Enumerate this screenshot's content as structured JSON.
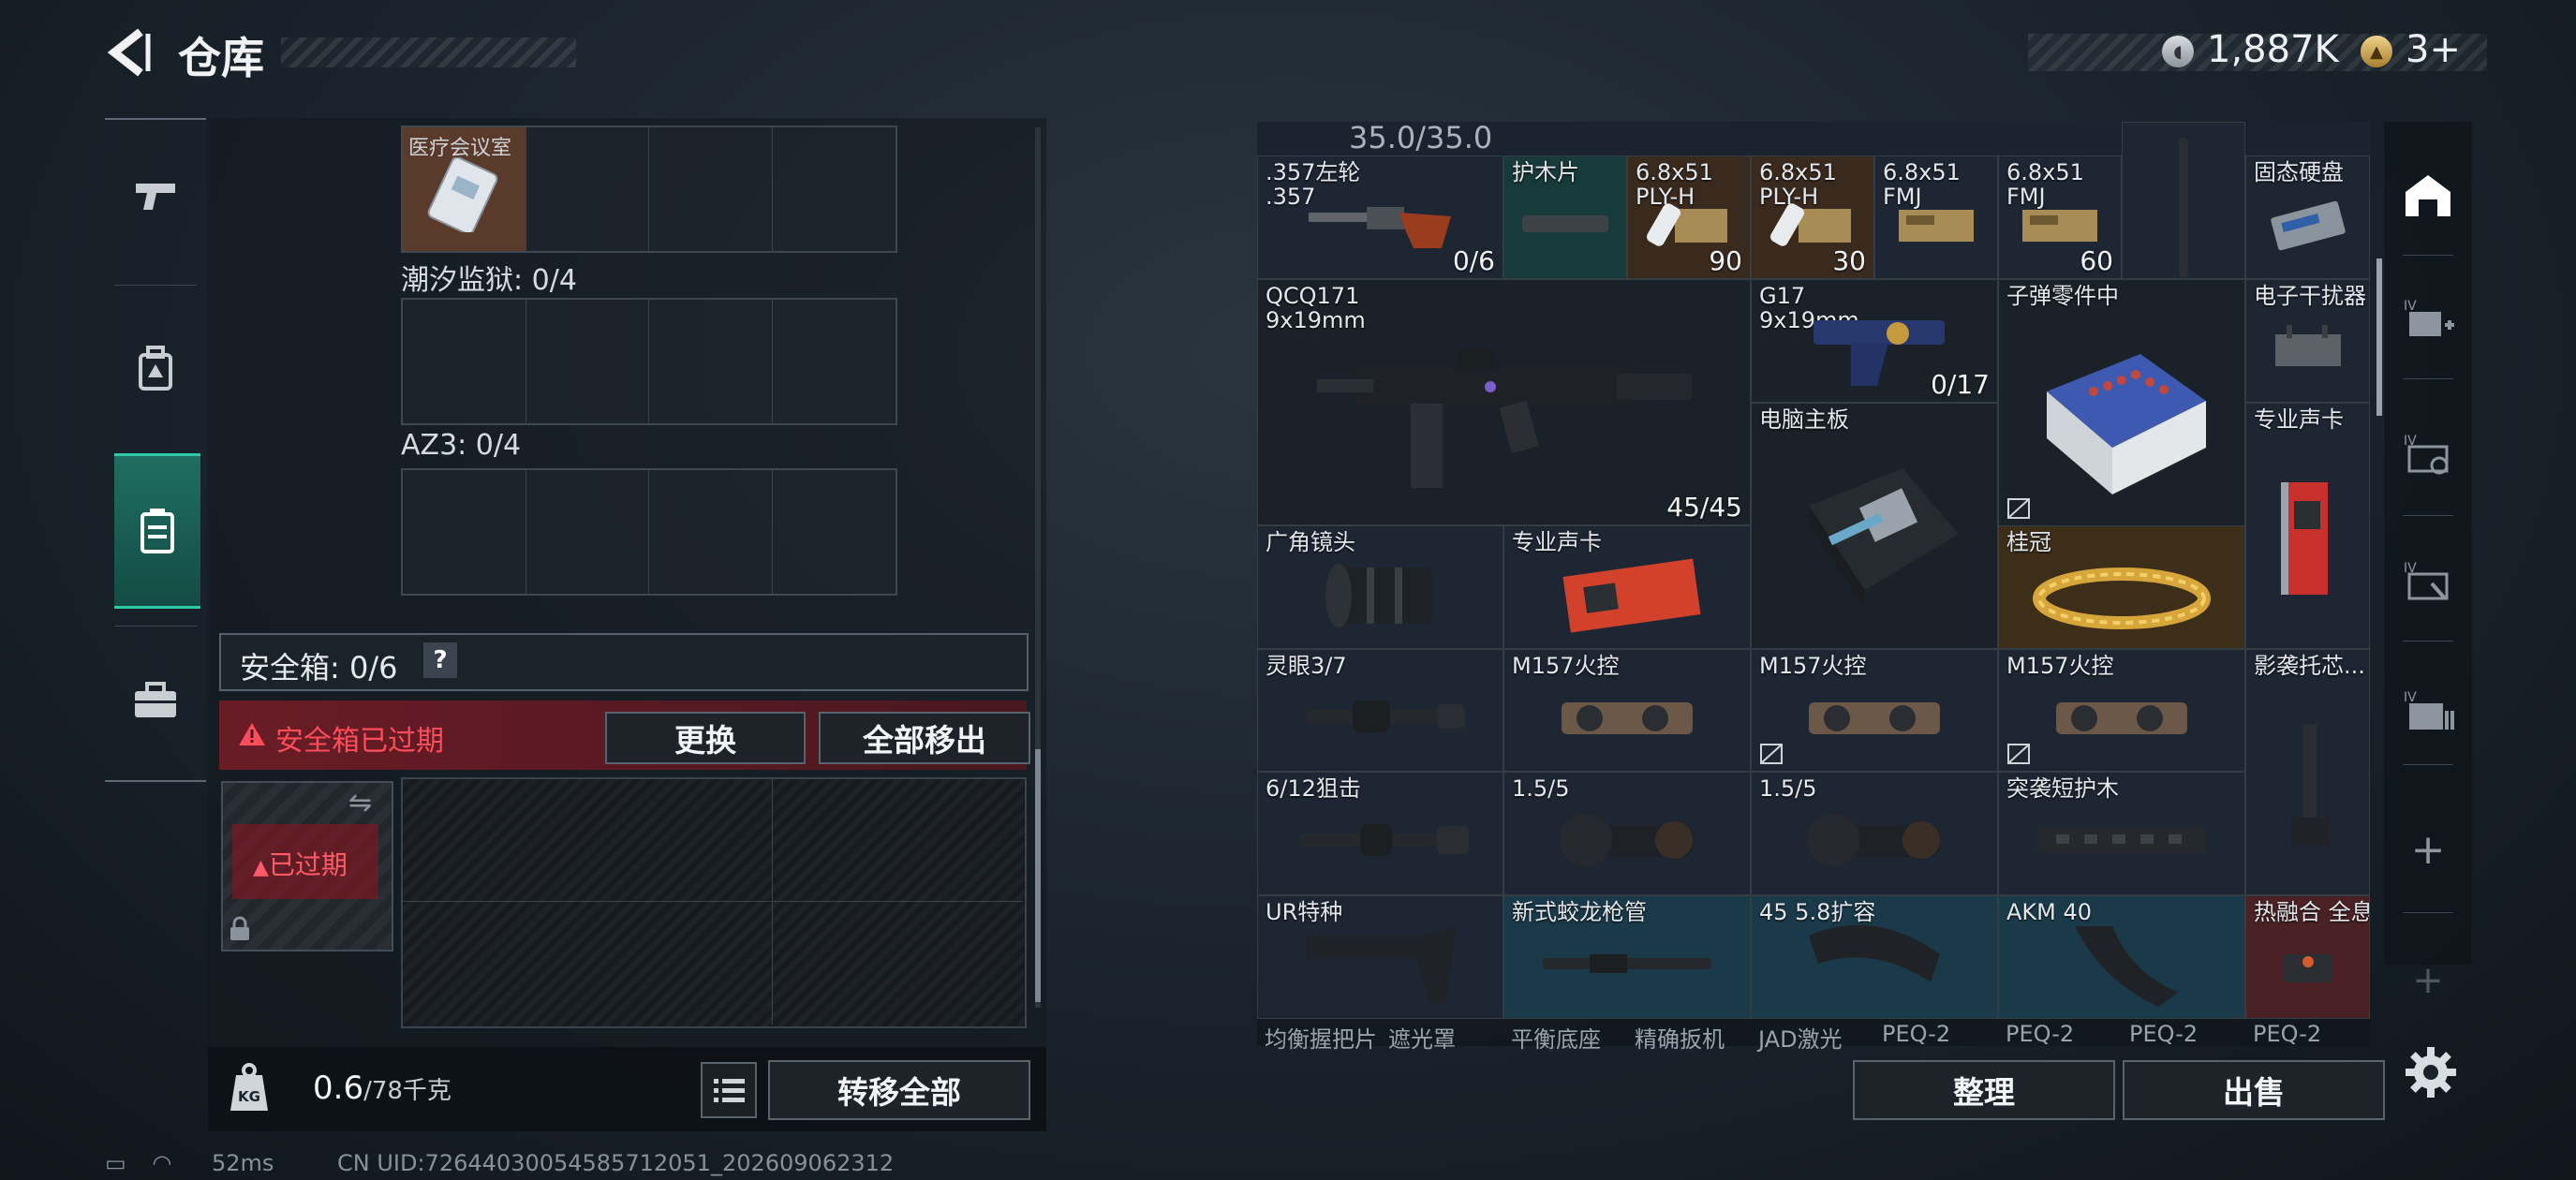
{
  "header": {
    "title": "仓库",
    "back_icon": "back-arrow-icon"
  },
  "currency": {
    "coin1_value": "1,887K",
    "coin1_icon": "silver-coin-icon",
    "coin2_value": "3+",
    "coin2_icon": "gold-coin-icon"
  },
  "left_rail": {
    "items": [
      "gun-icon",
      "backpack-icon",
      "chest-rig-icon",
      "briefcase-icon"
    ],
    "active_index": 2
  },
  "containers": {
    "top_item_name": "医疗会议室",
    "group1_label": "潮汐监狱: 0/4",
    "group2_label": "AZ3: 0/4"
  },
  "safe_box": {
    "label": "安全箱: 0/6",
    "help": "?",
    "warning": "安全箱已过期",
    "replace_btn": "更换",
    "move_all_btn": "全部移出",
    "expired_tag": "已过期",
    "swap_icon": "⇋"
  },
  "footer_left": {
    "weight": "0.6",
    "weight_max": "/78千克",
    "transfer_btn": "转移全部",
    "kg_icon": "KG"
  },
  "inventory": {
    "top_text": "35.0/35.0",
    "items": [
      {
        "name": ".357左轮\n.357",
        "count": "0/6"
      },
      {
        "name": "护木片",
        "count": ""
      },
      {
        "name": "6.8x51\nPLY-H",
        "count": "90"
      },
      {
        "name": "6.8x51\nPLY-H",
        "count": "30"
      },
      {
        "name": "6.8x51\nFMJ",
        "count": ""
      },
      {
        "name": "6.8x51\nFMJ",
        "count": "60"
      },
      {
        "name": "固态硬盘",
        "count": ""
      },
      {
        "name": "QCQ171\n9x19mm",
        "count": "45/45"
      },
      {
        "name": "G17\n9x19mm",
        "count": "0/17"
      },
      {
        "name": "子弹零件中",
        "count": ""
      },
      {
        "name": "电子干扰器",
        "count": ""
      },
      {
        "name": "电脑主板",
        "count": ""
      },
      {
        "name": "专业声卡",
        "count": ""
      },
      {
        "name": "广角镜头",
        "count": ""
      },
      {
        "name": "专业声卡",
        "count": ""
      },
      {
        "name": "桂冠",
        "count": ""
      },
      {
        "name": "灵眼3/7",
        "count": ""
      },
      {
        "name": "M157火控",
        "count": ""
      },
      {
        "name": "M157火控",
        "count": ""
      },
      {
        "name": "M157火控",
        "count": ""
      },
      {
        "name": "影袭托芯...",
        "count": ""
      },
      {
        "name": "6/12狙击",
        "count": ""
      },
      {
        "name": "1.5/5",
        "count": ""
      },
      {
        "name": "1.5/5",
        "count": ""
      },
      {
        "name": "突袭短护木",
        "count": ""
      },
      {
        "name": "UR特种",
        "count": ""
      },
      {
        "name": "新式蛟龙枪管",
        "count": ""
      },
      {
        "name": "45 5.8扩容",
        "count": ""
      },
      {
        "name": "AKM 40",
        "count": ""
      },
      {
        "name": "热融合 全息",
        "count": ""
      }
    ],
    "bottom_row": [
      "均衡握把片",
      "遮光罩",
      "平衡底座",
      "精确扳机",
      "JAD激光",
      "PEQ-2",
      "PEQ-2",
      "PEQ-2",
      "PEQ-2"
    ]
  },
  "right_rail": {
    "items": [
      "home-tab-icon",
      "add-ammo-icon",
      "magnify-gun-icon",
      "repair-icon",
      "storage-icon",
      "plus-icon",
      "plus-icon"
    ]
  },
  "actions": {
    "sort_btn": "整理",
    "sell_btn": "出售"
  },
  "status": {
    "ping": "52ms",
    "uid": "CN UID:726440300545857120​51_202609062312"
  }
}
